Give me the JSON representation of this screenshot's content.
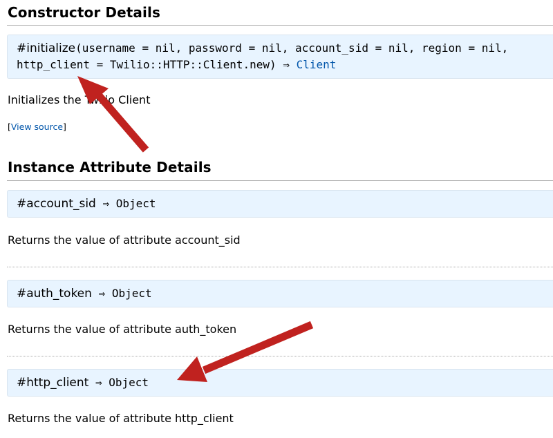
{
  "constructor_section": {
    "heading": "Constructor Details",
    "signature": {
      "name": "#initialize",
      "params_line1": "(username = nil, password = nil, account_sid = nil, region = nil,",
      "params_line2": "http_client = Twilio::HTTP::Client.new) ⇒ ",
      "return_link": "Client"
    },
    "description": "Initializes the Twilio Client",
    "view_source": {
      "open_bracket": "[",
      "label": "View source",
      "close_bracket": "]"
    }
  },
  "attributes_section": {
    "heading": "Instance Attribute Details",
    "items": [
      {
        "name": "#account_sid",
        "returns": " ⇒ Object",
        "description": "Returns the value of attribute account_sid"
      },
      {
        "name": "#auth_token",
        "returns": " ⇒ Object",
        "description": "Returns the value of attribute auth_token"
      },
      {
        "name": "#http_client",
        "returns": " ⇒ Object",
        "description": "Returns the value of attribute http_client"
      }
    ]
  },
  "annotations": {
    "arrow_color": "#c0221f"
  }
}
